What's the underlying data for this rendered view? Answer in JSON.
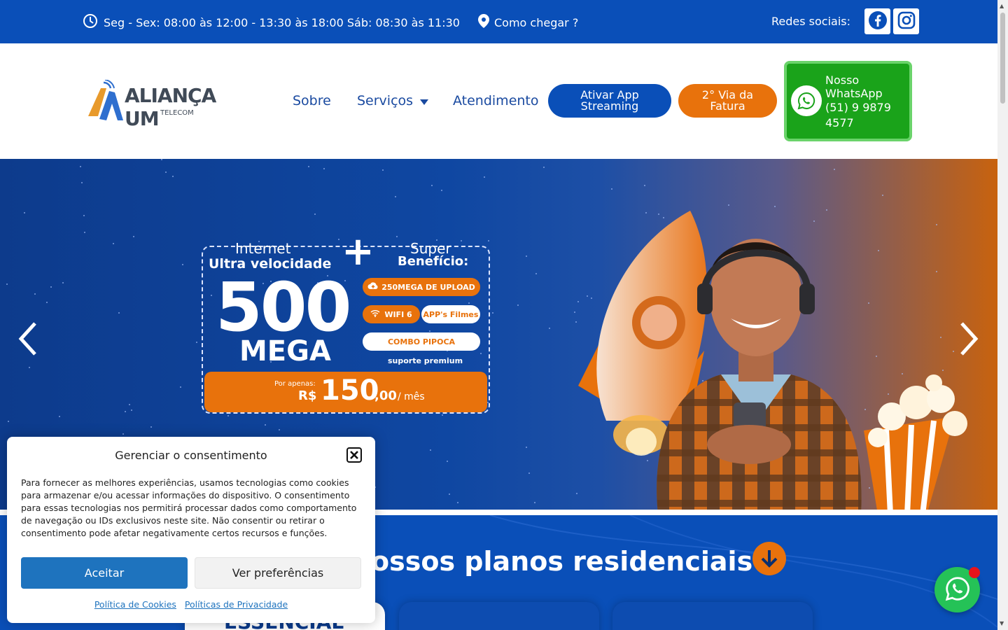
{
  "topbar": {
    "hours": "Seg - Sex: 08:00 às 12:00 - 13:30 às 18:00 Sáb: 08:30 às 11:30",
    "location": "Como chegar ?",
    "social_label": "Redes sociais:"
  },
  "header": {
    "logo_name": "ALIANÇA UM",
    "logo_sub": "TELECOM",
    "nav": [
      "Sobre",
      "Serviços",
      "Atendimento"
    ],
    "btn_app": "Ativar App Streaming",
    "btn_fatura": "2° Via da Fatura",
    "whatsapp_title": "Nosso WhatsApp",
    "whatsapp_number": "(51) 9 9879 4577"
  },
  "hero": {
    "internet": "Internet",
    "ultra": "Ultra velocidade",
    "plus": "+",
    "super": "Super",
    "beneficio": "Benefício:",
    "speed": "500",
    "unit": "MEGA",
    "pills": [
      "250MEGA DE UPLOAD",
      "WIFI 6",
      "APP's Filmes",
      "COMBO PIPOCA"
    ],
    "suporte": "suporte premium",
    "por_apenas": "Por apenas:",
    "currency": "R$",
    "price": "150",
    "cents": ",00",
    "per": "/ mês"
  },
  "section": {
    "title": "ossos planos residenciais",
    "card_label": "ESSENCIAL"
  },
  "consent": {
    "title": "Gerenciar o consentimento",
    "body": "Para fornecer as melhores experiências, usamos tecnologias como cookies para armazenar e/ou acessar informações do dispositivo. O consentimento para essas tecnologias nos permitirá processar dados como comportamento de navegação ou IDs exclusivos neste site. Não consentir ou retirar o consentimento pode afetar negativamente certos recursos e funções.",
    "accept": "Aceitar",
    "prefs": "Ver preferências",
    "link_cookies": "Política de Cookies",
    "link_privacy": "Políticas de Privacidade"
  },
  "colors": {
    "brand_blue": "#0a4fb8",
    "brand_orange": "#e8720c",
    "whatsapp_green": "#1aa31a"
  },
  "icons": [
    "clock-icon",
    "map-pin-icon",
    "facebook-icon",
    "instagram-icon",
    "whatsapp-icon",
    "chevron-left-icon",
    "chevron-right-icon",
    "arrow-down-icon",
    "close-icon"
  ]
}
